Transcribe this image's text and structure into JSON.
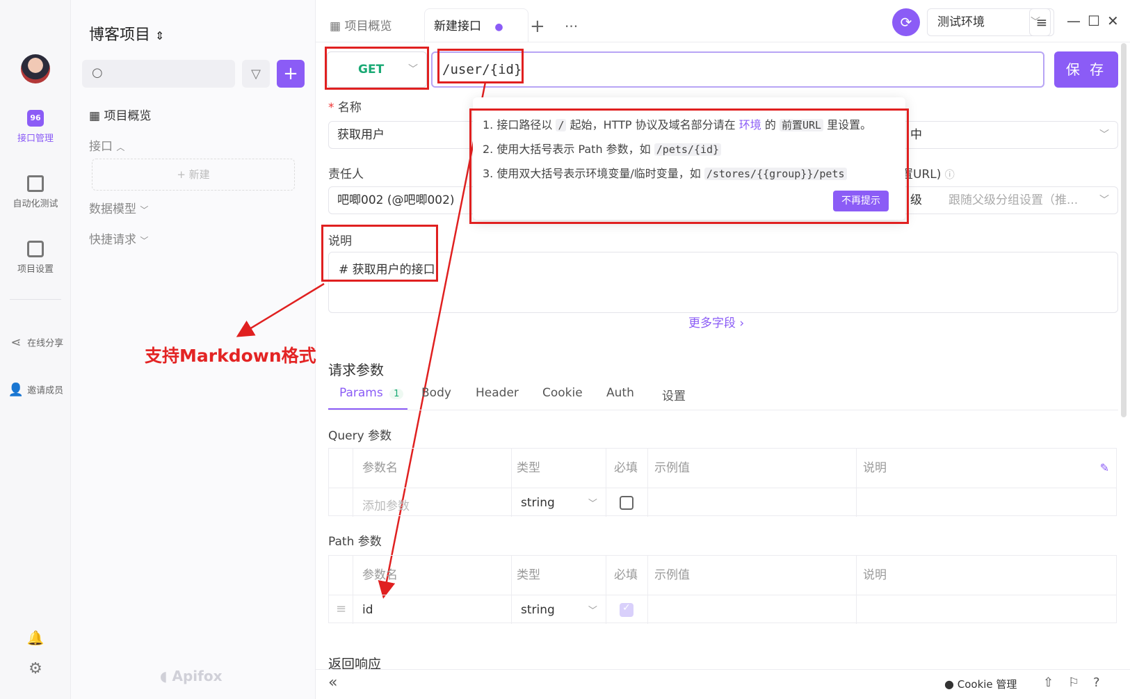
{
  "project": {
    "title": "博客项目",
    "search_placeholder": ""
  },
  "rail": {
    "items": [
      {
        "label": "接口管理",
        "icon": "api-management-icon"
      },
      {
        "label": "自动化测试",
        "icon": "automation-test-icon"
      },
      {
        "label": "项目设置",
        "icon": "project-settings-icon"
      },
      {
        "label": "在线分享",
        "icon": "share-icon"
      },
      {
        "label": "邀请成员",
        "icon": "invite-member-icon"
      }
    ]
  },
  "tree": {
    "overview": "项目概览",
    "interfaces": "接口",
    "new_label": "新建",
    "data_models": "数据模型",
    "quick_requests": "快捷请求"
  },
  "brand": "Apifox",
  "tabs": [
    {
      "label": "项目概览"
    },
    {
      "label": "新建接口"
    }
  ],
  "env": {
    "selected": "测试环境"
  },
  "request": {
    "method": "GET",
    "url": "/user/{id}",
    "save_label": "保 存"
  },
  "form": {
    "name_label": "名称",
    "name_value": "获取用户",
    "status_value": "中",
    "owner_label": "责任人",
    "owner_value": "吧唧002 (@吧唧002)",
    "prefix_label": "置URL)",
    "level_label": "级",
    "level_value": "跟随父级分组设置（推...",
    "desc_label": "说明",
    "desc_value": "# 获取用户的接口",
    "more_fields": "更多字段 ›"
  },
  "annotation": "支持Markdown格式",
  "tooltip": {
    "line1_a": "1. 接口路径以",
    "line1_code": "/",
    "line1_b": "起始，HTTP 协议及域名部分请在",
    "line1_link": "环境",
    "line1_c": "的",
    "line1_code2": "前置URL",
    "line1_d": "里设置。",
    "line2_a": "2. 使用大括号表示 Path 参数，如",
    "line2_code": "/pets/{id}",
    "line3_a": "3. 使用双大括号表示环境变量/临时变量，如",
    "line3_code": "/stores/{{group}}/pets",
    "button": "不再提示"
  },
  "params": {
    "section_title": "请求参数",
    "tabs": [
      "Params",
      "Body",
      "Header",
      "Cookie",
      "Auth",
      "设置"
    ],
    "params_count": "1",
    "query_label": "Query 参数",
    "path_label": "Path 参数",
    "headers": {
      "name": "参数名",
      "type": "类型",
      "required": "必填",
      "example": "示例值",
      "desc": "说明"
    },
    "query_row": {
      "name_placeholder": "添加参数",
      "type": "string"
    },
    "path_row": {
      "name": "id",
      "type": "string"
    }
  },
  "response_title": "返回响应",
  "bottom": {
    "cookie": "Cookie 管理",
    "collapse": "«"
  }
}
